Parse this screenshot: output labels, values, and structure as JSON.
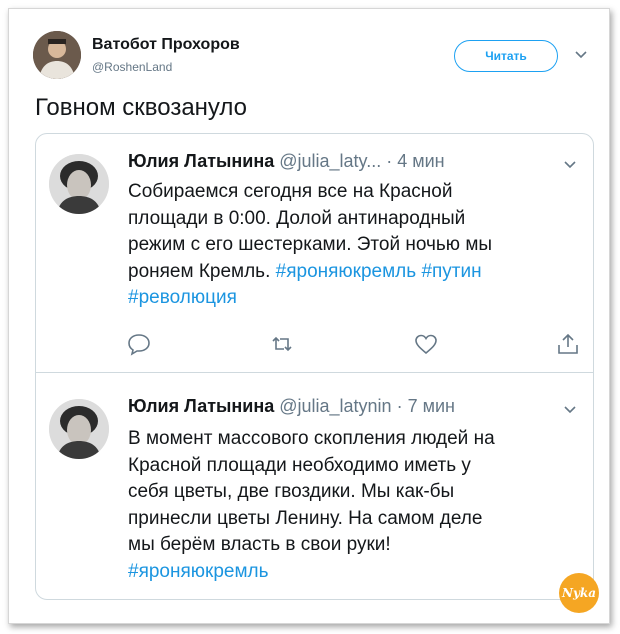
{
  "author": {
    "name": "Ватобот Прохоров",
    "handle": "@RoshenLand",
    "follow_label": "Читать",
    "caret_icon": "chevron-down-icon"
  },
  "tweet": {
    "text": "Говном сквозануло"
  },
  "quote": {
    "tweets": [
      {
        "name": "Юлия Латынина",
        "handle": "@julia_laty...",
        "time": "· 4 мин",
        "lines": [
          "Собираемся сегодня все на Красной",
          "площади в 0:00. Долой антинародный",
          "режим с его шестерками. Этой ночью мы",
          "роняем Кремль."
        ],
        "hashtags": [
          "#яроняюкремль",
          "#путин",
          "#революция"
        ],
        "actions": [
          "reply-icon",
          "retweet-icon",
          "like-icon",
          "share-icon"
        ]
      },
      {
        "name": "Юлия Латынина",
        "handle": "@julia_latynin",
        "time": "· 7 мин",
        "lines": [
          "В момент массового скопления людей на",
          "Красной площади необходимо иметь у",
          "себя цветы, две гвоздики. Мы как-бы",
          "принесли цветы Ленину. На самом деле",
          "мы берём власть в свои руки!"
        ],
        "hashtags": [
          "#яроняюкремль"
        ]
      }
    ]
  },
  "watermark": {
    "text": "Nyka",
    "color": "#f5a623"
  },
  "colors": {
    "link": "#1b95e0",
    "accent": "#1da1f2",
    "muted": "#657786",
    "border": "#cfd9de"
  }
}
